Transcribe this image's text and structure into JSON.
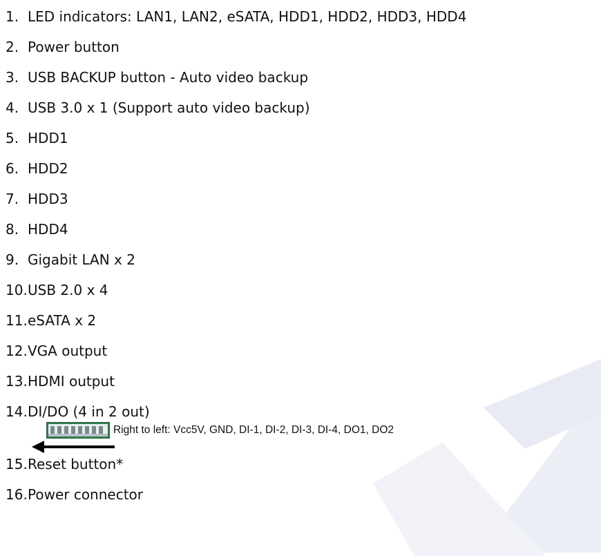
{
  "items": [
    {
      "num": "1.",
      "text": "LED indicators: LAN1, LAN2, eSATA, HDD1, HDD2, HDD3, HDD4"
    },
    {
      "num": "2.",
      "text": "Power button"
    },
    {
      "num": "3.",
      "text": "USB BACKUP button - Auto video backup"
    },
    {
      "num": "4.",
      "text": "USB 3.0 x 1 (Support auto video backup)"
    },
    {
      "num": "5.",
      "text": "HDD1"
    },
    {
      "num": "6.",
      "text": "HDD2"
    },
    {
      "num": "7.",
      "text": "HDD3"
    },
    {
      "num": "8.",
      "text": "HDD4"
    },
    {
      "num": "9.",
      "text": "Gigabit LAN x 2"
    },
    {
      "num": "10.",
      "text": "USB 2.0 x 4"
    },
    {
      "num": "11.",
      "text": "eSATA x 2"
    },
    {
      "num": "12.",
      "text": "VGA output"
    },
    {
      "num": "13.",
      "text": "HDMI output"
    },
    {
      "num": "14.",
      "text": "DI/DO (4 in 2 out)"
    },
    {
      "num": "15.",
      "text": "Reset button*"
    },
    {
      "num": "16.",
      "text": "Power connector"
    }
  ],
  "dido_note": "Right to left: Vcc5V, GND, DI-1, DI-2, DI-3, DI-4, DO1, DO2",
  "colors": {
    "text": "#111111",
    "watermark": "#e4e6f2",
    "connector_body": "#3a8f5a"
  },
  "icons": [
    "terminal-block-connector-icon",
    "left-arrow-icon"
  ]
}
